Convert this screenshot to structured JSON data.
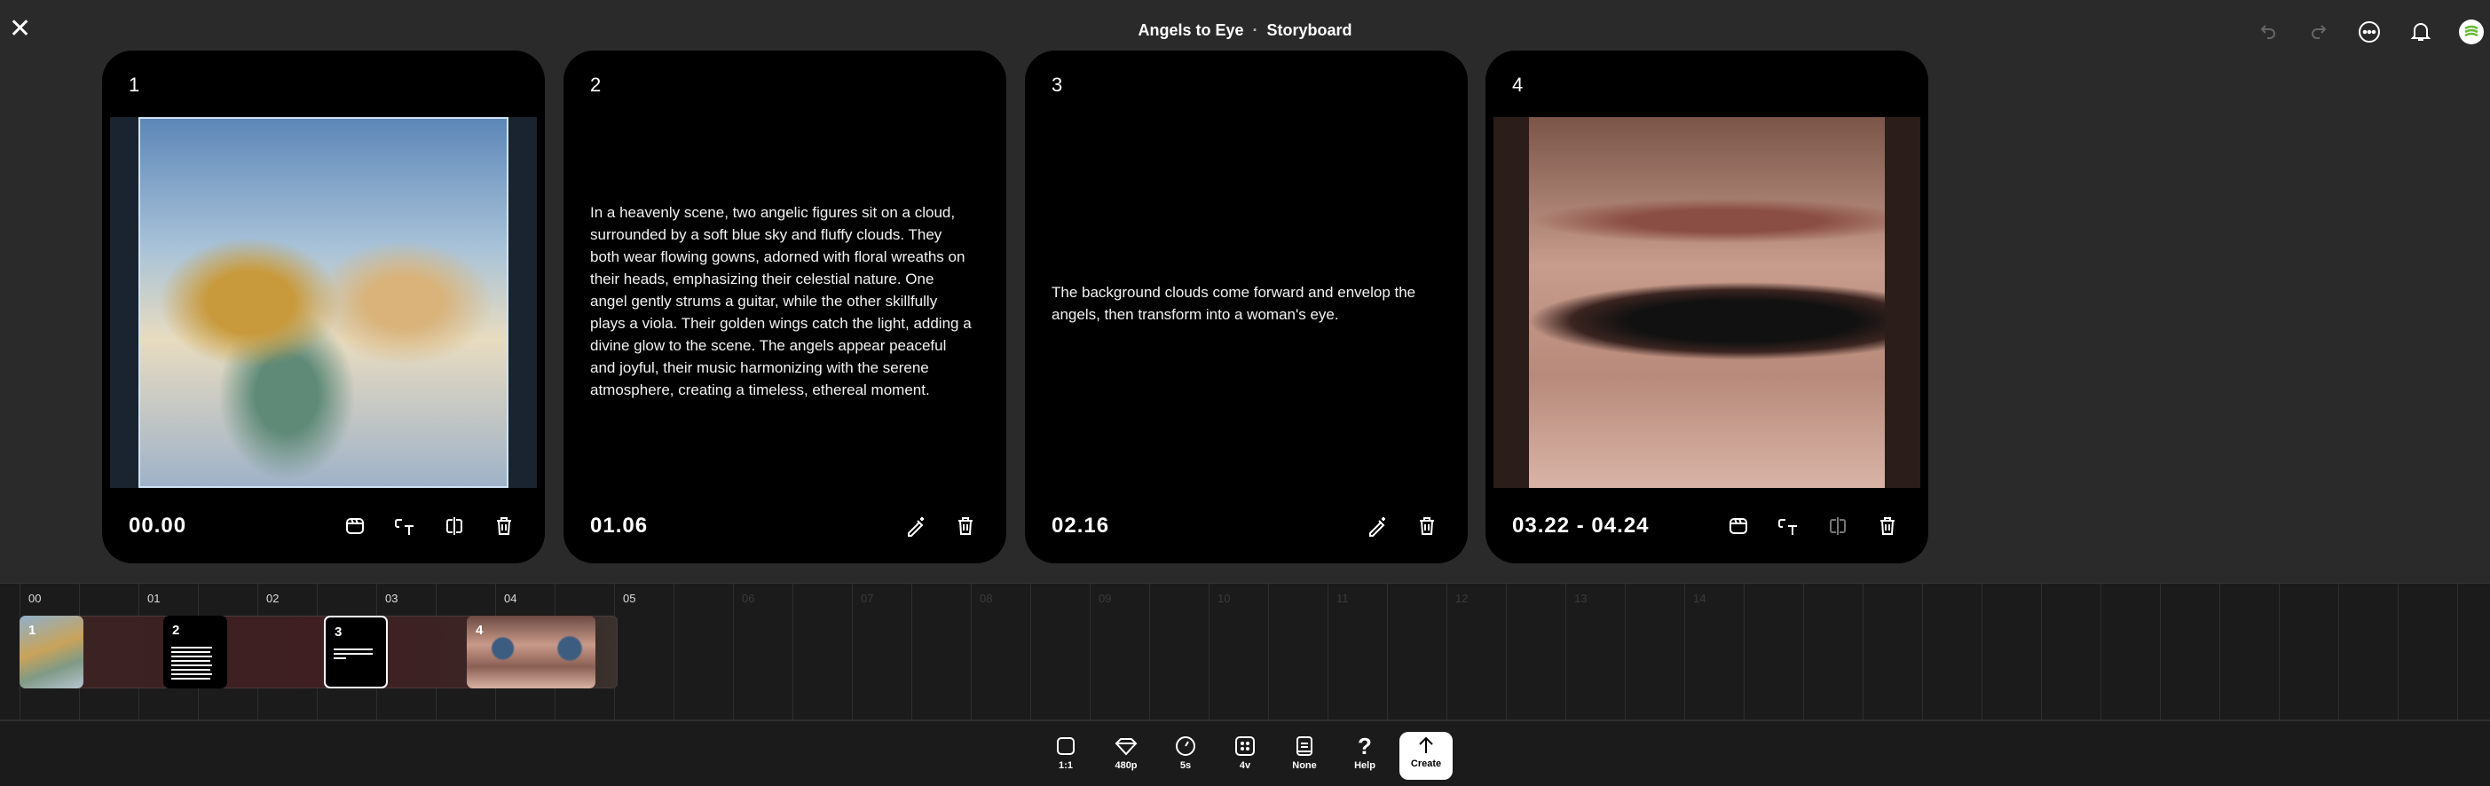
{
  "header": {
    "project": "Angels to Eye",
    "separator": "·",
    "view": "Storyboard"
  },
  "header_icons": [
    "undo-icon",
    "redo-icon",
    "more-icon",
    "bell-icon",
    "avatar"
  ],
  "cards": [
    {
      "number": "1",
      "time": "00.00",
      "type": "image"
    },
    {
      "number": "2",
      "time": "01.06",
      "type": "text",
      "text": "In a heavenly scene, two angelic figures sit on a cloud, surrounded by a soft blue sky and fluffy clouds. They both wear flowing gowns, adorned with floral wreaths on their heads, emphasizing their celestial nature. One angel gently strums a guitar, while the other skillfully plays a viola. Their golden wings catch the light, adding a divine glow to the scene. The angels appear peaceful and joyful, their music harmonizing with the serene atmosphere, creating a timeless, ethereal moment."
    },
    {
      "number": "3",
      "time": "02.16",
      "type": "text",
      "text": "The background clouds come forward and envelop the angels, then transform into a woman's eye."
    },
    {
      "number": "4",
      "time": "03.22 - 04.24",
      "type": "image"
    }
  ],
  "timeline": {
    "labels": [
      "00",
      "01",
      "02",
      "03",
      "04",
      "05",
      "06",
      "07",
      "08",
      "09",
      "10",
      "11",
      "12",
      "13",
      "14"
    ],
    "active_until": 5,
    "clips": [
      "1",
      "2",
      "3",
      "4"
    ]
  },
  "toolbar": [
    {
      "label": "1:1",
      "icon": "aspect-ratio-icon"
    },
    {
      "label": "480p",
      "icon": "diamond-icon"
    },
    {
      "label": "5s",
      "icon": "duration-icon"
    },
    {
      "label": "4v",
      "icon": "variations-icon"
    },
    {
      "label": "None",
      "icon": "preset-icon"
    },
    {
      "label": "Help",
      "icon": "help-icon"
    }
  ],
  "create_label": "Create"
}
